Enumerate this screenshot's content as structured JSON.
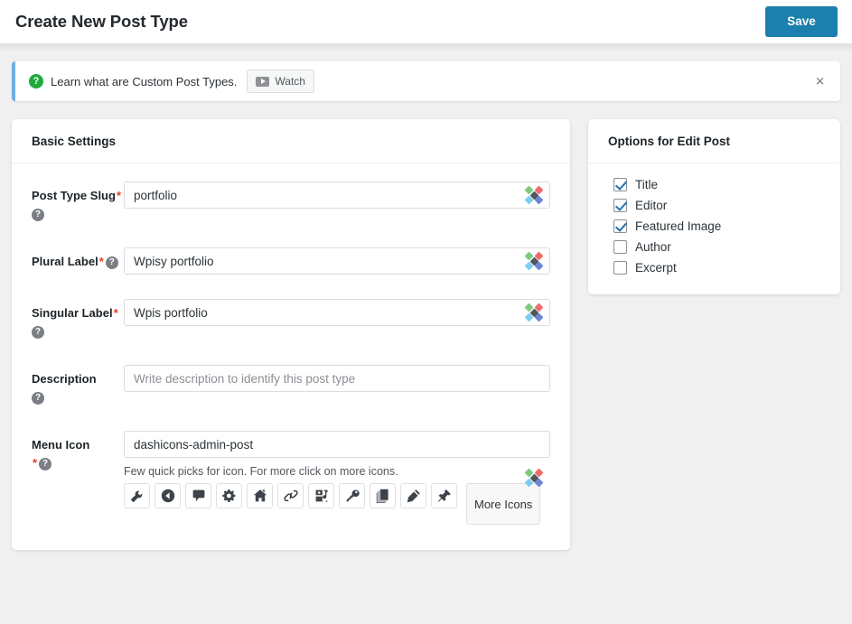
{
  "header": {
    "title": "Create New Post Type",
    "save_label": "Save"
  },
  "notice": {
    "icon": "question-mark-icon",
    "text": "Learn what are Custom Post Types.",
    "watch_label": "Watch",
    "close_label": "✕",
    "accent_color": "#72aee6",
    "icon_color": "#1faa3c"
  },
  "basic_settings": {
    "card_title": "Basic Settings",
    "fields": [
      {
        "label": "Post Type Slug",
        "required": true,
        "help": "?",
        "value": "portfolio",
        "placeholder": "",
        "has_diamonds": true
      },
      {
        "label": "Plural Label",
        "required": true,
        "help": "?",
        "value": "Wpisy portfolio",
        "placeholder": "",
        "has_diamonds": true
      },
      {
        "label": "Singular Label",
        "required": true,
        "help": "?",
        "value": "Wpis portfolio",
        "placeholder": "",
        "has_diamonds": true
      },
      {
        "label": "Description",
        "required": false,
        "help": "?",
        "value": "",
        "placeholder": "Write description to identify this post type",
        "has_diamonds": false
      },
      {
        "label": "Menu Icon",
        "required": true,
        "help": "?",
        "value": "dashicons-admin-post",
        "placeholder": "",
        "has_diamonds": true
      }
    ],
    "icon_picker": {
      "hint": "Few quick picks for icon. For more click on more icons.",
      "more_label": "More Icons",
      "icons": [
        "admin-tools-icon",
        "arrow-left-circle-icon",
        "comment-icon",
        "gear-icon",
        "home-icon",
        "link-icon",
        "media-icon",
        "key-icon",
        "pages-icon",
        "plugin-icon",
        "pin-icon"
      ]
    }
  },
  "options_panel": {
    "card_title": "Options for Edit Post",
    "items": [
      {
        "label": "Title",
        "checked": true
      },
      {
        "label": "Editor",
        "checked": true
      },
      {
        "label": "Featured Image",
        "checked": true
      },
      {
        "label": "Author",
        "checked": false
      },
      {
        "label": "Excerpt",
        "checked": false
      }
    ]
  },
  "colors": {
    "accent_blue": "#1c7fad",
    "page_bg": "#f0f0f1",
    "required_red": "#e2401c",
    "check_blue": "#2271b1"
  }
}
